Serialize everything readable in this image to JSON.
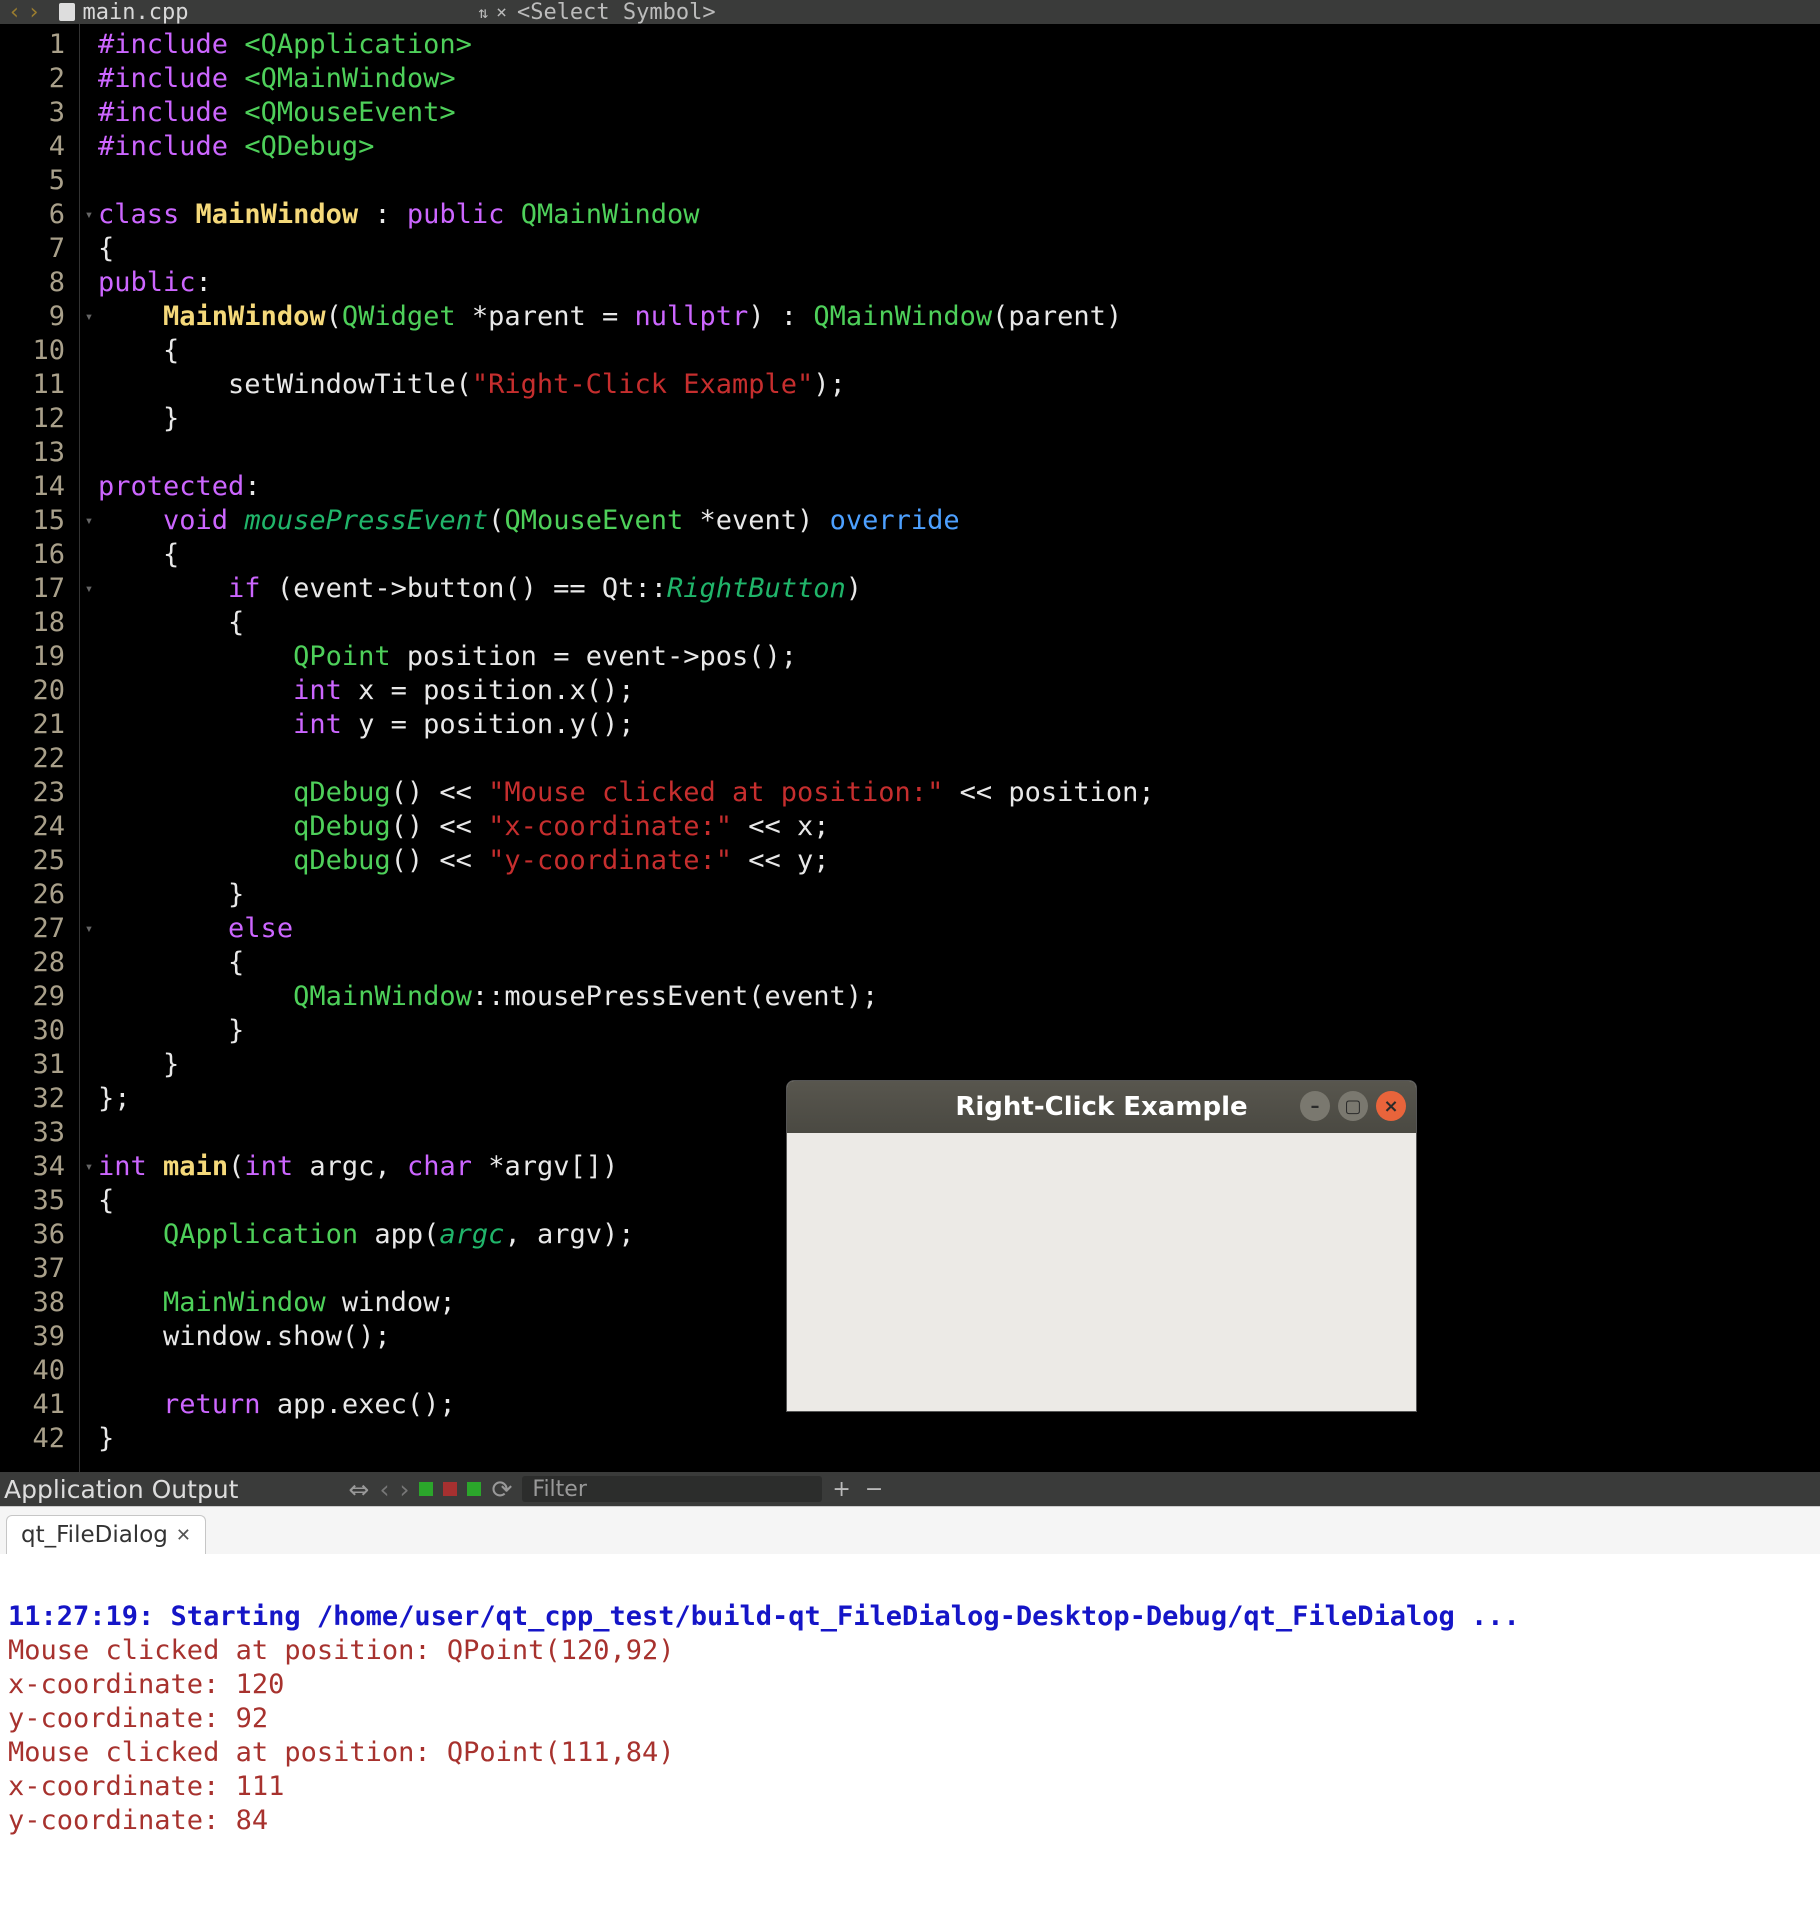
{
  "tabbar": {
    "file_name": "main.cpp",
    "symbol_selector": "<Select Symbol>"
  },
  "code": {
    "lines": [
      {
        "n": 1,
        "html": "<span class='kw-inc'>#include</span> <span class='hdr'>&lt;QApplication&gt;</span>"
      },
      {
        "n": 2,
        "html": "<span class='kw-inc'>#include</span> <span class='hdr'>&lt;QMainWindow&gt;</span>"
      },
      {
        "n": 3,
        "html": "<span class='kw-inc'>#include</span> <span class='hdr'>&lt;QMouseEvent&gt;</span>"
      },
      {
        "n": 4,
        "html": "<span class='kw-inc'>#include</span> <span class='hdr'>&lt;QDebug&gt;</span>"
      },
      {
        "n": 5,
        "html": ""
      },
      {
        "n": 6,
        "fold": "▾",
        "html": "<span class='kw-inc'>class</span> <span class='fname'>MainWindow</span> <span class='white'>:</span> <span class='kw-inc'>public</span> <span class='cls'>QMainWindow</span>"
      },
      {
        "n": 7,
        "html": "<span class='white'>{</span>"
      },
      {
        "n": 8,
        "html": "<span class='kw-inc'>public</span><span class='white'>:</span>"
      },
      {
        "n": 9,
        "fold": "▾",
        "html": "    <span class='fname'>MainWindow</span><span class='white'>(</span><span class='cls'>QWidget</span> <span class='white'>*parent = </span><span class='kw-inc'>nullptr</span><span class='white'>) : </span><span class='cls'>QMainWindow</span><span class='white'>(parent)</span>"
      },
      {
        "n": 10,
        "html": "    <span class='white'>{</span>"
      },
      {
        "n": 11,
        "html": "        <span class='white'>setWindowTitle(</span><span class='str'>\"Right-Click Example\"</span><span class='white'>);</span>"
      },
      {
        "n": 12,
        "html": "    <span class='white'>}</span>"
      },
      {
        "n": 13,
        "html": ""
      },
      {
        "n": 14,
        "html": "<span class='kw-inc'>protected</span><span class='white'>:</span>"
      },
      {
        "n": 15,
        "fold": "▾",
        "html": "    <span class='kw-inc'>void</span> <span class='ital'>mousePressEvent</span><span class='white'>(</span><span class='cls'>QMouseEvent</span> <span class='white'>*event) </span><span class='kw-blue'>override</span>"
      },
      {
        "n": 16,
        "html": "    <span class='white'>{</span>"
      },
      {
        "n": 17,
        "fold": "▾",
        "html": "        <span class='kw-inc'>if</span> <span class='white'>(event-&gt;button() == Qt::</span><span class='em'>RightButton</span><span class='white'>)</span>"
      },
      {
        "n": 18,
        "html": "        <span class='white'>{</span>"
      },
      {
        "n": 19,
        "html": "            <span class='cls'>QPoint</span> <span class='white'>position = event-&gt;pos();</span>"
      },
      {
        "n": 20,
        "html": "            <span class='kw-inc'>int</span> <span class='white'>x = position.x();</span>"
      },
      {
        "n": 21,
        "html": "            <span class='kw-inc'>int</span> <span class='white'>y = position.y();</span>"
      },
      {
        "n": 22,
        "html": ""
      },
      {
        "n": 23,
        "html": "            <span class='cls'>qDebug</span><span class='white'>() &lt;&lt; </span><span class='str'>\"Mouse clicked at position:\"</span><span class='white'> &lt;&lt; position;</span>"
      },
      {
        "n": 24,
        "html": "            <span class='cls'>qDebug</span><span class='white'>() &lt;&lt; </span><span class='str'>\"x-coordinate:\"</span><span class='white'> &lt;&lt; x;</span>"
      },
      {
        "n": 25,
        "html": "            <span class='cls'>qDebug</span><span class='white'>() &lt;&lt; </span><span class='str'>\"y-coordinate:\"</span><span class='white'> &lt;&lt; y;</span>"
      },
      {
        "n": 26,
        "html": "        <span class='white'>}</span>"
      },
      {
        "n": 27,
        "fold": "▾",
        "html": "        <span class='kw-inc'>else</span>"
      },
      {
        "n": 28,
        "html": "        <span class='white'>{</span>"
      },
      {
        "n": 29,
        "html": "            <span class='cls'>QMainWindow</span><span class='white'>::mousePressEvent(event);</span>"
      },
      {
        "n": 30,
        "html": "        <span class='white'>}</span>"
      },
      {
        "n": 31,
        "html": "    <span class='white'>}</span>"
      },
      {
        "n": 32,
        "html": "<span class='white'>};</span>"
      },
      {
        "n": 33,
        "html": ""
      },
      {
        "n": 34,
        "fold": "▾",
        "html": "<span class='kw-inc'>int</span> <span class='main'>main</span><span class='white'>(</span><span class='kw-inc'>int</span> <span class='white'>argc, </span><span class='kw-inc'>char</span> <span class='white'>*argv[])</span>"
      },
      {
        "n": 35,
        "html": "<span class='white'>{</span>"
      },
      {
        "n": 36,
        "html": "    <span class='cls'>QApplication</span> <span class='white'>app(</span><span class='ital'>argc</span><span class='white'>, argv);</span>"
      },
      {
        "n": 37,
        "html": ""
      },
      {
        "n": 38,
        "html": "    <span class='cls'>MainWindow</span> <span class='white'>window;</span>"
      },
      {
        "n": 39,
        "html": "    <span class='white'>window.show();</span>"
      },
      {
        "n": 40,
        "html": ""
      },
      {
        "n": 41,
        "html": "    <span class='kw-inc'>return</span> <span class='white'>app.exec();</span>"
      },
      {
        "n": 42,
        "html": "<span class='white'>}</span>"
      }
    ]
  },
  "appwin": {
    "title": "Right-Click Example"
  },
  "panel": {
    "title": "Application Output",
    "filter_placeholder": "Filter",
    "tab": "qt_FileDialog"
  },
  "output": {
    "start_line": "11:27:19: Starting /home/user/qt_cpp_test/build-qt_FileDialog-Desktop-Debug/qt_FileDialog ...",
    "lines": [
      "Mouse clicked at position: QPoint(120,92)",
      "x-coordinate: 120",
      "y-coordinate: 92",
      "Mouse clicked at position: QPoint(111,84)",
      "x-coordinate: 111",
      "y-coordinate: 84"
    ]
  }
}
